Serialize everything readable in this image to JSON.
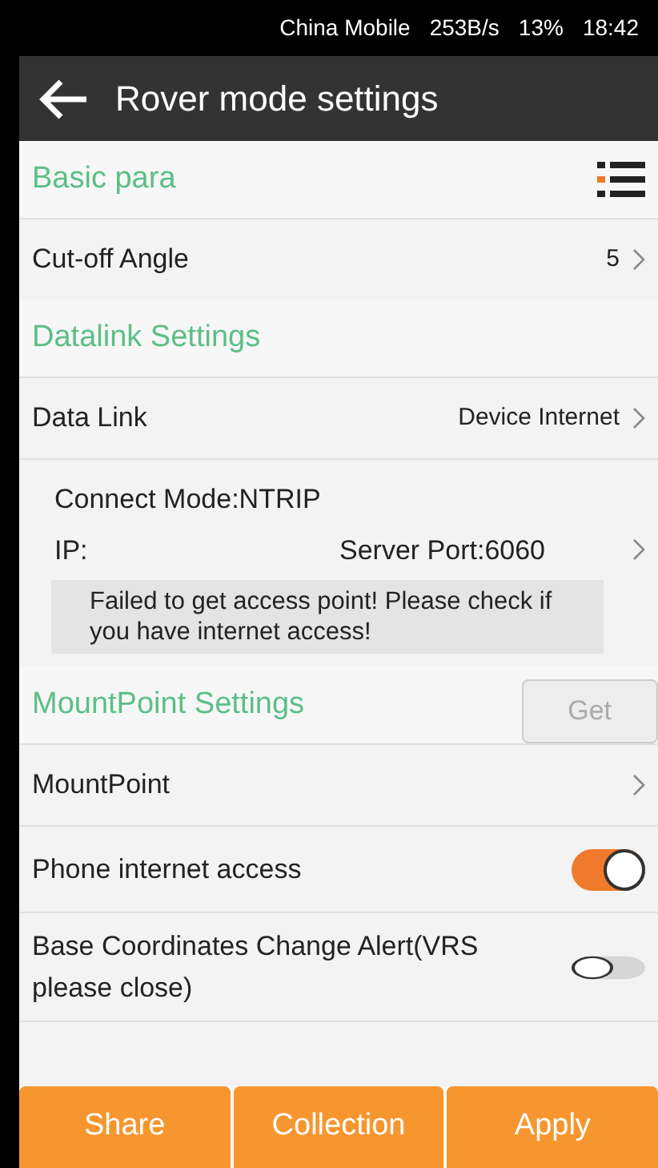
{
  "status_bar": {
    "carrier": "China Mobile",
    "network": "253B/s",
    "battery": "13%",
    "time": "18:42"
  },
  "header": {
    "title": "Rover mode settings"
  },
  "sections": [
    {
      "title": "Basic para",
      "rows": [
        {
          "kind": "value",
          "label": "Cut-off Angle",
          "value": "5"
        }
      ]
    },
    {
      "title": "Datalink Settings",
      "rows": [
        {
          "kind": "value",
          "label": "Data Link",
          "value": "Device Internet"
        },
        {
          "kind": "connection",
          "mode": "Connect Mode:NTRIP",
          "ip": "IP:",
          "port": "Server Port:6060"
        }
      ]
    },
    {
      "title": "MountPoint Settings",
      "action": "Get",
      "rows": [
        {
          "kind": "link",
          "label": "MountPoint"
        },
        {
          "kind": "toggle",
          "label": "Phone internet access",
          "on": true
        },
        {
          "kind": "toggle",
          "label": "Base Coordinates Change Alert(VRS please close)",
          "on": false
        }
      ]
    }
  ],
  "toast": "Failed to get access point! Please check if you have internet access!",
  "buttons": [
    "Share",
    "Collection",
    "Apply"
  ]
}
